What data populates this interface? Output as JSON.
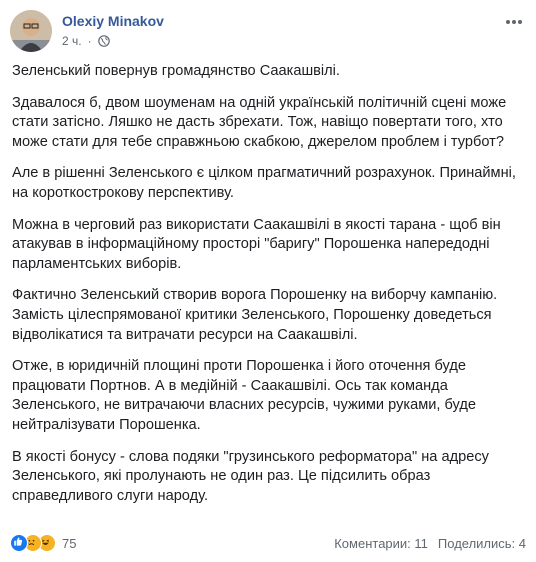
{
  "post": {
    "author": "Olexiy Minakov",
    "time": "2 ч.",
    "separator": "·",
    "paragraphs": [
      "Зеленський повернув громадянство Саакашвілі.",
      "Здавалося б, двом шоуменам на одній українській політичній сцені може стати затісно. Ляшко не дасть збрехати. Тож, навіщо повертати того, хто може стати для тебе справжньою скабкою, джерелом проблем і турбот?",
      "Але в рішенні Зеленського є цілком прагматичний розрахунок. Принаймні, на короткострокову перспективу.",
      "Можна в черговий раз використати Саакашвілі в якості тарана - щоб він атакував в інформаційному просторі \"баригу\" Порошенка напередодні парламентських виборів.",
      "Фактично Зеленський створив ворога Порошенку на виборчу кампанію. Замість цілеспрямованої критики Зеленського, Порошенку доведеться відволікатися та витрачати ресурси на Саакашвілі.",
      "Отже, в юридичній площині проти Порошенка і його оточення буде працювати Портнов. А в медійній - Саакашвілі. Ось так команда Зеленського, не витрачаючи власних ресурсів, чужими руками, буде нейтралізувати Порошенка.",
      "В якості бонусу - слова подяки \"грузинського реформатора\" на адресу Зеленського, які пролунають не один раз. Це підсилить образ справедливого слуги народу."
    ]
  },
  "footer": {
    "reactions_count": "75",
    "comments": "Коментарии: 11",
    "shares": "Поделились: 4"
  },
  "colors": {
    "author_link": "#365899",
    "secondary_text": "#606770",
    "like_blue": "#1877f2",
    "emoji_yellow": "#f7b125"
  },
  "icons": [
    "globe-icon",
    "more-options-icon",
    "like-reaction-icon",
    "sad-reaction-icon",
    "haha-reaction-icon"
  ]
}
